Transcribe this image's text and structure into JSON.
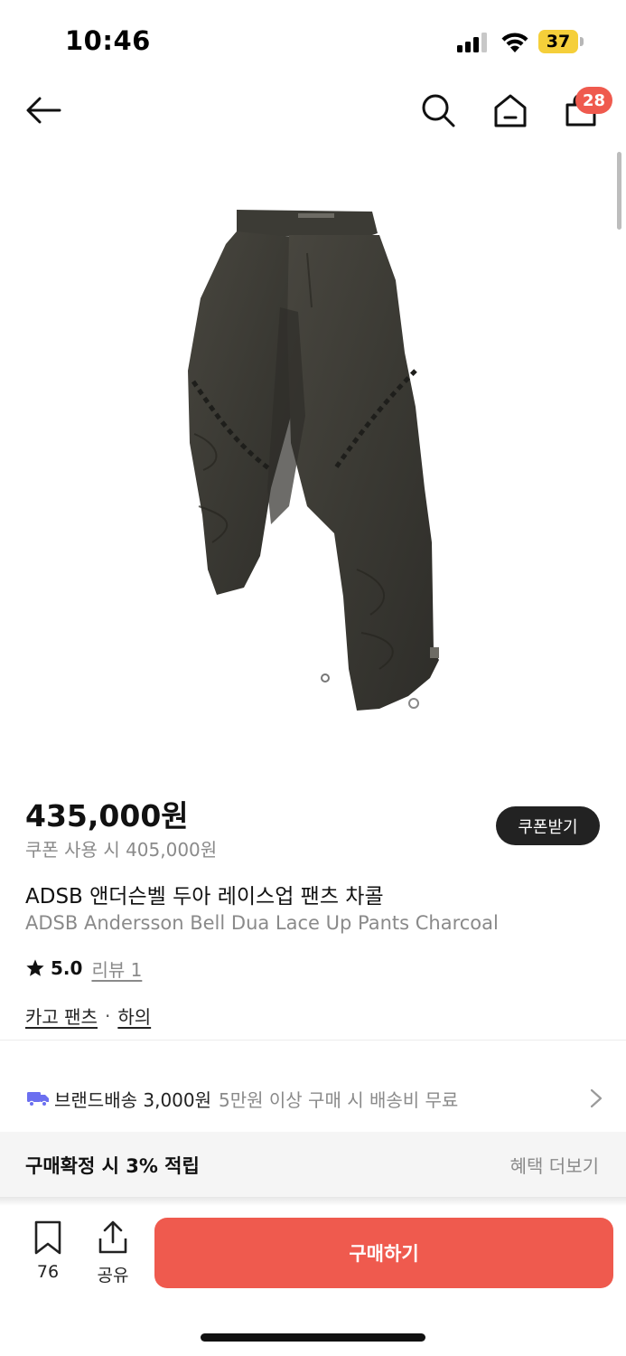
{
  "status_bar": {
    "time": "10:46",
    "battery": "37",
    "battery_color": "#f5cf3a"
  },
  "nav": {
    "back_icon": "arrow-left-icon",
    "search_icon": "search-icon",
    "home_icon": "home-icon",
    "cart_icon": "shopping-bag-icon",
    "cart_count": "28"
  },
  "product": {
    "price": "435,000원",
    "coupon_price": "쿠폰 사용 시 405,000원",
    "coupon_button": "쿠폰받기",
    "title_ko": "ADSB 앤더슨벨 두아 레이스업 팬츠 차콜",
    "title_en": "ADSB Andersson Bell Dua Lace Up Pants Charcoal",
    "rating": "5.0",
    "review_link": "리뷰 1",
    "category_1": "카고 팬츠",
    "category_separator": "·",
    "category_2": "하의"
  },
  "shipping": {
    "icon": "truck-icon",
    "label": "브랜드배송 3,000원",
    "note": "5만원 이상 구매 시 배송비 무료"
  },
  "benefit": {
    "text": "구매확정 시 3% 적립",
    "more": "혜택 더보기"
  },
  "bottom_bar": {
    "bookmark_count": "76",
    "share_label": "공유",
    "buy_label": "구매하기",
    "accent_color": "#ef5a4e"
  }
}
